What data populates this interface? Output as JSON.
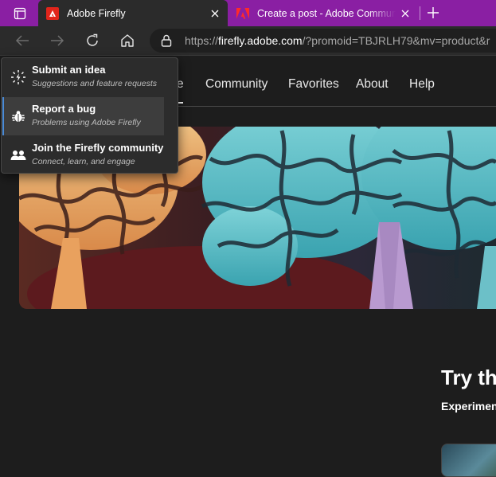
{
  "browser": {
    "tabs": [
      {
        "title": "Adobe Firefly",
        "active": true
      },
      {
        "title": "Create a post - Adobe Communi",
        "active": false
      }
    ],
    "url": {
      "scheme": "https://",
      "host": "firefly.adobe.com",
      "path": "/?promoid=TBJRLH79&mv=product&r"
    },
    "colors": {
      "tab_strip": "#8a1fa3",
      "toolbar": "#2b2b2b"
    }
  },
  "nav": {
    "items": [
      {
        "label": "e"
      },
      {
        "label": "Community"
      },
      {
        "label": "Favorites"
      },
      {
        "label": "About"
      },
      {
        "label": "Help"
      }
    ]
  },
  "help_menu": {
    "items": [
      {
        "title": "Submit an idea",
        "description": "Suggestions and feature requests",
        "icon": "lightbulb-icon"
      },
      {
        "title": "Report a bug",
        "description": "Problems using Adobe Firefly",
        "icon": "bug-icon",
        "hovered": true
      },
      {
        "title": "Join the Firefly community",
        "description": "Connect, learn, and engage",
        "icon": "community-icon"
      }
    ]
  },
  "main": {
    "try_title": "Try th",
    "try_subtitle": "Experimen"
  }
}
